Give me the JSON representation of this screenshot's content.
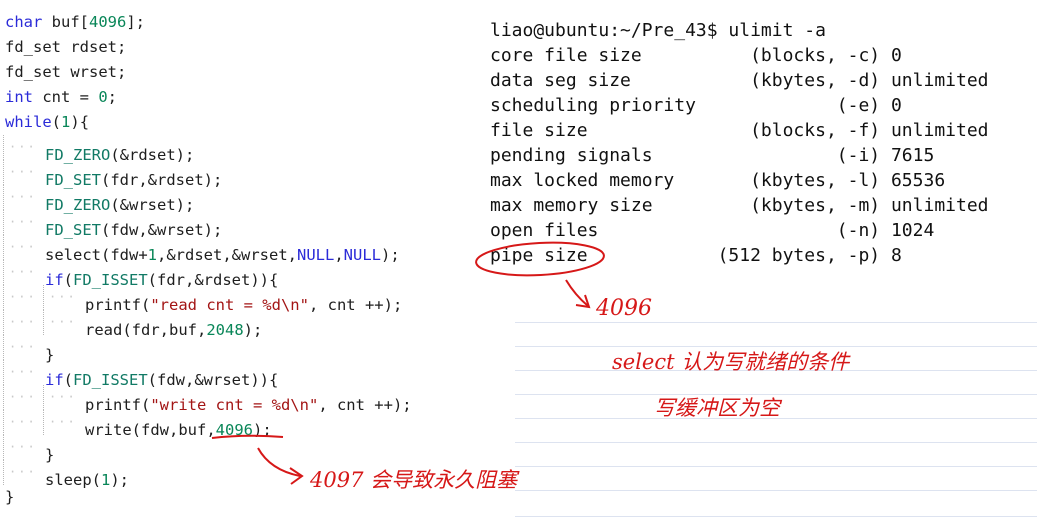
{
  "code": {
    "lines": [
      {
        "parts": [
          [
            "kw",
            "char"
          ],
          [
            "",
            " buf["
          ],
          [
            "num",
            "4096"
          ],
          [
            "",
            "];"
          ]
        ]
      },
      {
        "parts": [
          [
            "",
            "fd_set rdset;"
          ]
        ]
      },
      {
        "parts": [
          [
            "",
            "fd_set wrset;"
          ]
        ]
      },
      {
        "parts": [
          [
            "kw",
            "int"
          ],
          [
            "",
            " cnt = "
          ],
          [
            "num",
            "0"
          ],
          [
            "",
            ";"
          ]
        ]
      },
      {
        "parts": [
          [
            "kw",
            "while"
          ],
          [
            "",
            "("
          ],
          [
            "num",
            "1"
          ],
          [
            "",
            "){"
          ]
        ]
      },
      {
        "indent": 1,
        "parts": [
          [
            "fn",
            "FD_ZERO"
          ],
          [
            "",
            "(&rdset);"
          ]
        ]
      },
      {
        "indent": 1,
        "parts": [
          [
            "fn",
            "FD_SET"
          ],
          [
            "",
            "(fdr,&rdset);"
          ]
        ]
      },
      {
        "indent": 1,
        "parts": [
          [
            "fn",
            "FD_ZERO"
          ],
          [
            "",
            "(&wrset);"
          ]
        ]
      },
      {
        "indent": 1,
        "parts": [
          [
            "fn",
            "FD_SET"
          ],
          [
            "",
            "(fdw,&wrset);"
          ]
        ]
      },
      {
        "indent": 1,
        "parts": [
          [
            "",
            "select(fdw+"
          ],
          [
            "num",
            "1"
          ],
          [
            "",
            ",&rdset,&wrset,"
          ],
          [
            "kw",
            "NULL"
          ],
          [
            "",
            ","
          ],
          [
            "kw",
            "NULL"
          ],
          [
            "",
            ");"
          ]
        ]
      },
      {
        "indent": 1,
        "parts": [
          [
            "kw",
            "if"
          ],
          [
            "",
            "("
          ],
          [
            "fn",
            "FD_ISSET"
          ],
          [
            "",
            "(fdr,&rdset)){"
          ]
        ]
      },
      {
        "indent": 2,
        "parts": [
          [
            "",
            "printf("
          ],
          [
            "str",
            "\"read cnt = %d\\n\""
          ],
          [
            "",
            ", cnt ++);"
          ]
        ]
      },
      {
        "indent": 2,
        "parts": [
          [
            "",
            "read(fdr,buf,"
          ],
          [
            "num",
            "2048"
          ],
          [
            "",
            ");"
          ]
        ]
      },
      {
        "indent": 1,
        "parts": [
          [
            "",
            "}"
          ]
        ]
      },
      {
        "indent": 1,
        "parts": [
          [
            "kw",
            "if"
          ],
          [
            "",
            "("
          ],
          [
            "fn",
            "FD_ISSET"
          ],
          [
            "",
            "(fdw,&wrset)){"
          ]
        ]
      },
      {
        "indent": 2,
        "parts": [
          [
            "",
            "printf("
          ],
          [
            "str",
            "\"write cnt = %d\\n\""
          ],
          [
            "",
            ", cnt ++);"
          ]
        ]
      },
      {
        "indent": 2,
        "parts": [
          [
            "",
            "write(fdw,buf,"
          ],
          [
            "num",
            "4096"
          ],
          [
            "",
            ");"
          ]
        ]
      },
      {
        "indent": 1,
        "parts": [
          [
            "",
            "}"
          ]
        ]
      },
      {
        "indent": 1,
        "parts": [
          [
            "",
            "sleep("
          ],
          [
            "num",
            "1"
          ],
          [
            "",
            ");"
          ]
        ]
      },
      {
        "parts": [
          [
            "",
            "}"
          ]
        ]
      }
    ]
  },
  "terminal": {
    "prompt": "liao@ubuntu:~/Pre_43$ ulimit -a",
    "rows": [
      "core file size          (blocks, -c) 0",
      "data seg size           (kbytes, -d) unlimited",
      "scheduling priority             (-e) 0",
      "file size               (blocks, -f) unlimited",
      "pending signals                 (-i) 7615",
      "max locked memory       (kbytes, -l) 65536",
      "max memory size         (kbytes, -m) unlimited",
      "open files                      (-n) 1024",
      "pipe size            (512 bytes, -p) 8"
    ]
  },
  "annotations": {
    "pipe_size_note": "4096",
    "select_note_line1": "select 认为写就绪的条件",
    "select_note_line2": "写缓冲区为空",
    "write_note": "4097 会导致永久阻塞"
  },
  "colors": {
    "keyword": "#2b2bd8",
    "function": "#117a65",
    "number": "#098658",
    "string": "#a31515",
    "annotation": "#d61818"
  }
}
